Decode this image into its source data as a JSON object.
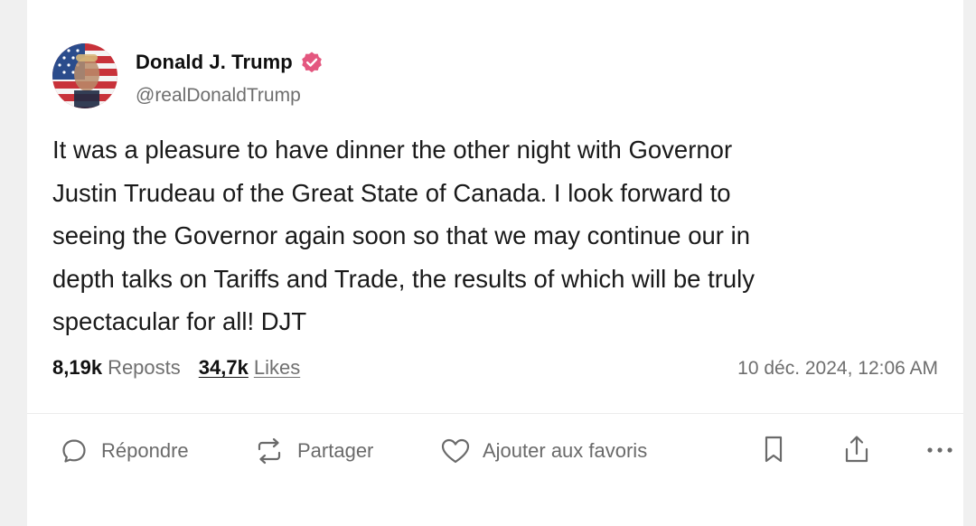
{
  "post": {
    "author_name": "Donald J. Trump",
    "handle": "@realDonaldTrump",
    "text_lines": [
      "It was a pleasure to have dinner the other night with Governor",
      "Justin Trudeau of the Great State of Canada. I look forward to",
      "seeing the Governor again soon so that we may continue our in",
      "depth talks on Tariffs and Trade, the results of which will be truly",
      "spectacular for all! DJT"
    ],
    "reposts_count": "8,19k",
    "reposts_label": "Reposts",
    "likes_count": "34,7k",
    "likes_label": "Likes",
    "timestamp": "10 déc. 2024, 12:06 AM"
  },
  "actions": {
    "reply_label": "Répondre",
    "share_label": "Partager",
    "favorite_label": "Ajouter aux favoris"
  },
  "colors": {
    "verified_badge": "#e4577f",
    "card_background": "#ffffff",
    "page_background": "#f0f0f0",
    "muted_text": "#6e6e6e"
  },
  "icons": [
    "verified-badge-icon",
    "reply-icon",
    "repost-icon",
    "heart-icon",
    "bookmark-icon",
    "share-icon",
    "more-icon"
  ]
}
